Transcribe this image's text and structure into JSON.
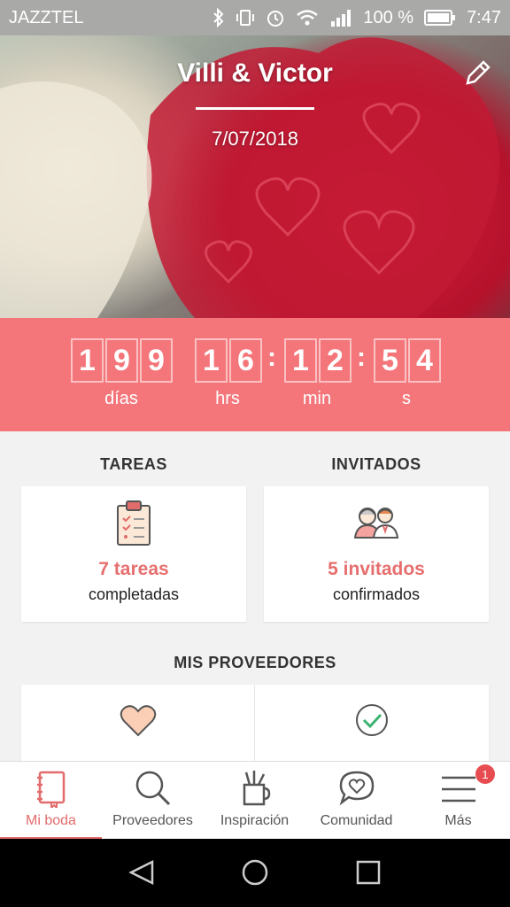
{
  "status_bar": {
    "carrier": "JAZZTEL",
    "battery": "100 %",
    "time": "7:47"
  },
  "header": {
    "couple_names": "Villi & Victor",
    "date": "7/07/2018"
  },
  "countdown": {
    "days_digits": [
      "1",
      "9",
      "9"
    ],
    "hours_digits": [
      "1",
      "6"
    ],
    "minutes_digits": [
      "1",
      "2"
    ],
    "seconds_digits": [
      "5",
      "4"
    ],
    "separator": ":",
    "days_label": "días",
    "hours_label": "hrs",
    "minutes_label": "min",
    "seconds_label": "s"
  },
  "tasks": {
    "title": "TAREAS",
    "count_text": "7 tareas",
    "sub_text": "completadas",
    "icon": "clipboard-checklist-icon"
  },
  "guests": {
    "title": "INVITADOS",
    "count_text": "5 invitados",
    "sub_text": "confirmados",
    "icon": "couple-icon"
  },
  "vendors": {
    "title": "MIS PROVEEDORES",
    "cards": [
      {
        "icon": "heart-icon"
      },
      {
        "icon": "check-circle-icon"
      }
    ]
  },
  "bottom_nav": {
    "items": [
      {
        "label": "Mi boda",
        "icon": "notebook-icon",
        "active": true
      },
      {
        "label": "Proveedores",
        "icon": "search-icon",
        "active": false
      },
      {
        "label": "Inspiración",
        "icon": "pencil-cup-icon",
        "active": false
      },
      {
        "label": "Comunidad",
        "icon": "chat-heart-icon",
        "active": false
      },
      {
        "label": "Más",
        "icon": "menu-icon",
        "active": false,
        "badge": "1"
      }
    ]
  },
  "colors": {
    "accent": "#f4767a",
    "active_nav": "#e26b6b",
    "count_text": "#e66f6f"
  }
}
